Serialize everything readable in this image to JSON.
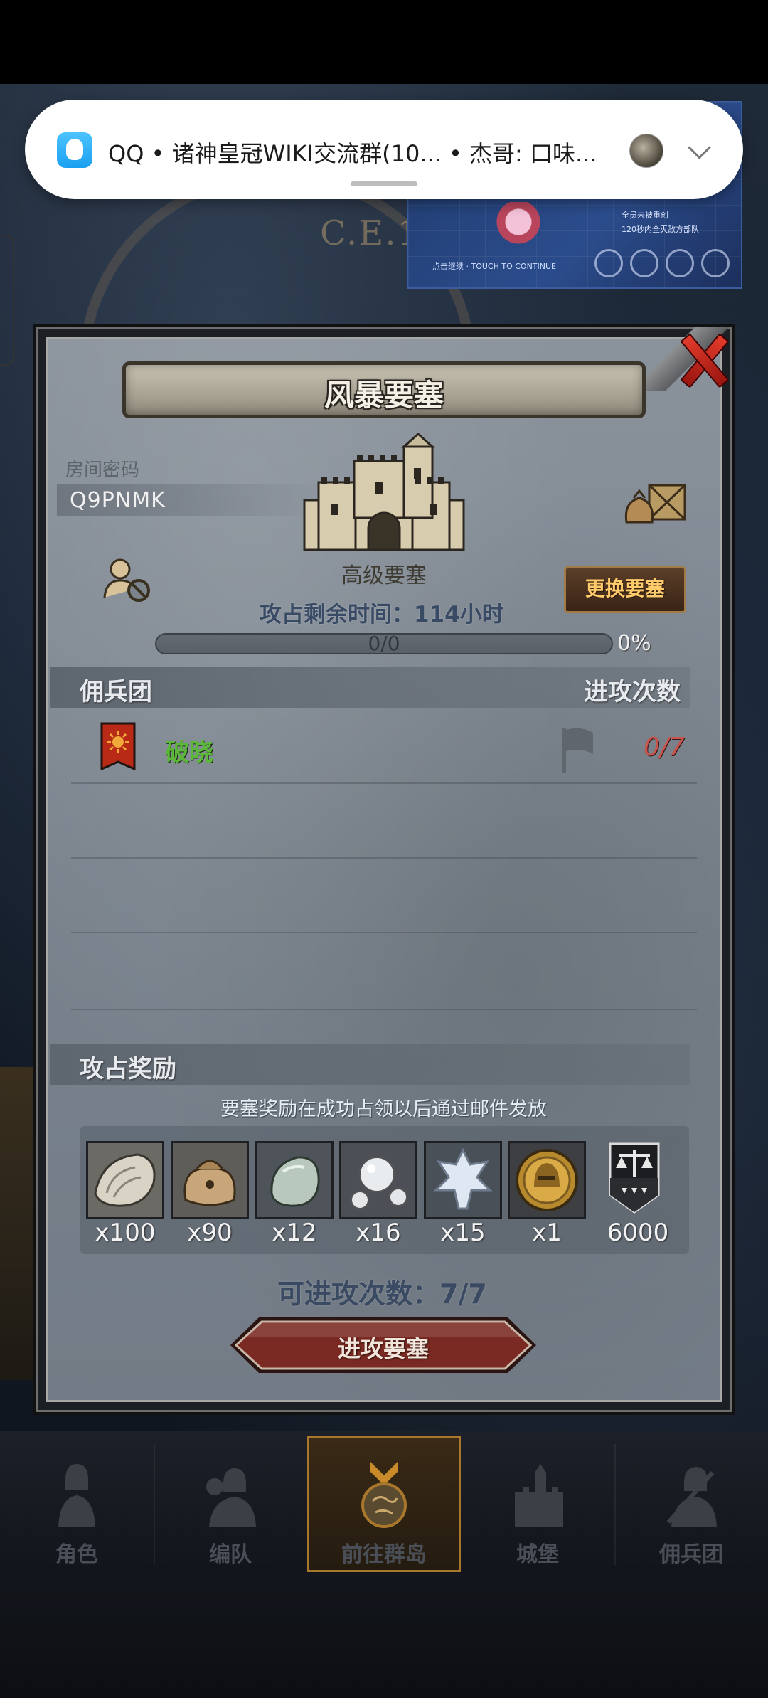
{
  "notification": {
    "app": "QQ",
    "text": "QQ • 诸神皇冠WIKI交流群(10... • 杰哥: 口味..."
  },
  "background": {
    "year_text": "C.E.1C",
    "pip_lines": [
      "全员未被重创",
      "120秒内全灭敌方部队"
    ],
    "pip_footer": "点击继续 · TOUCH TO CONTINUE"
  },
  "dialog": {
    "title": "风暴要塞",
    "room_label": "房间密码",
    "room_code": "Q9PNMK",
    "castle_name": "高级要塞",
    "change_button": "更换要塞",
    "remaining_time": "攻占剩余时间：114小时",
    "progress": {
      "text": "0/0",
      "percent": "0%",
      "fraction": 0
    },
    "merc_header": "佣兵团",
    "attack_header": "进攻次数",
    "mercenaries": [
      {
        "name": "破晓",
        "attacks": "0/7",
        "banner_color": "#b82a16",
        "name_color": "#5cb83a"
      }
    ],
    "reward_header": "攻占奖励",
    "reward_note": "要塞奖励在成功占领以后通过邮件发放",
    "rewards": [
      {
        "icon": "oyster-icon",
        "qty": "x100"
      },
      {
        "icon": "pouch-icon",
        "qty": "x90"
      },
      {
        "icon": "stone-icon",
        "qty": "x12"
      },
      {
        "icon": "pearls-icon",
        "qty": "x16"
      },
      {
        "icon": "crystal-icon",
        "qty": "x15"
      },
      {
        "icon": "helmet-medal-icon",
        "qty": "x1"
      },
      {
        "icon": "scales-banner-icon",
        "qty": "6000"
      }
    ],
    "available_attacks": "可进攻次数：7/7",
    "attack_button": "进攻要塞"
  },
  "nav": {
    "items": [
      {
        "label": "角色",
        "icon": "knight-icon"
      },
      {
        "label": "编队",
        "icon": "formation-icon"
      },
      {
        "label": "前往群岛",
        "icon": "globe-icon",
        "active": true
      },
      {
        "label": "城堡",
        "icon": "castle-icon"
      },
      {
        "label": "佣兵团",
        "icon": "mercenary-icon"
      }
    ]
  },
  "colors": {
    "accent_gold": "#d9a640",
    "merc_name_green": "#5cb83a",
    "attack_count_red": "#c9534d",
    "close_red": "#e23b2b"
  }
}
